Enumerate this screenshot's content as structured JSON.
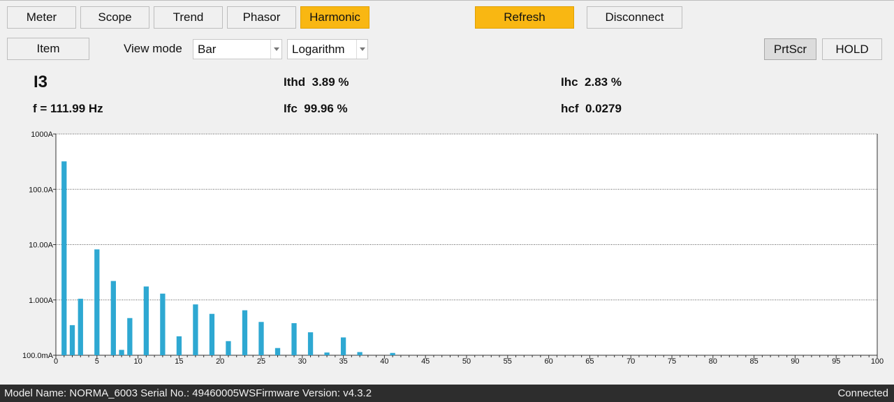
{
  "tabs": [
    {
      "label": "Meter"
    },
    {
      "label": "Scope"
    },
    {
      "label": "Trend"
    },
    {
      "label": "Phasor"
    },
    {
      "label": "Harmonic"
    }
  ],
  "toolbar": {
    "refresh_label": "Refresh",
    "disconnect_label": "Disconnect",
    "item_label": "Item",
    "view_mode_label": "View mode",
    "view_mode_value": "Bar",
    "scale_value": "Logarithm",
    "prtscr_label": "PrtScr",
    "hold_label": "HOLD"
  },
  "readout": {
    "channel": "I3",
    "freq": "f = 111.99 Hz",
    "ithd_label": "Ithd",
    "ithd_value": "3.89 %",
    "ifc_label": "Ifc",
    "ifc_value": "99.96 %",
    "ihc_label": "Ihc",
    "ihc_value": "2.83 %",
    "hcf_label": "hcf",
    "hcf_value": "0.0279"
  },
  "colors": {
    "active_tab": "#f9b712",
    "bar": "#2ea8d2",
    "status_bg": "#2d2d2d"
  },
  "chart_data": {
    "type": "bar",
    "scale": "log",
    "ylim_amps": [
      0.1,
      1000
    ],
    "y_tick_labels": [
      "1000A",
      "100.0A",
      "10.00A",
      "1.000A",
      "100.0mA"
    ],
    "y_tick_values": [
      1000,
      100,
      10,
      1,
      0.1
    ],
    "xlim": [
      0,
      100
    ],
    "x_ticks": [
      0,
      5,
      10,
      15,
      20,
      25,
      30,
      35,
      40,
      45,
      50,
      55,
      60,
      65,
      70,
      75,
      80,
      85,
      90,
      95,
      100
    ],
    "grid": true,
    "harmonics": [
      1,
      2,
      3,
      5,
      7,
      8,
      9,
      11,
      13,
      15,
      17,
      19,
      21,
      23,
      25,
      27,
      29,
      31,
      33,
      35,
      37,
      41
    ],
    "values": [
      320,
      0.35,
      1.05,
      8.2,
      2.2,
      0.125,
      0.47,
      1.75,
      1.3,
      0.22,
      0.83,
      0.56,
      0.18,
      0.65,
      0.4,
      0.135,
      0.38,
      0.26,
      0.112,
      0.21,
      0.114,
      0.11
    ]
  },
  "status": {
    "device_info": "Model Name:  NORMA_6003 Serial No.:  49460005WSFirmware Version:  v4.3.2",
    "connection": "Connected"
  }
}
